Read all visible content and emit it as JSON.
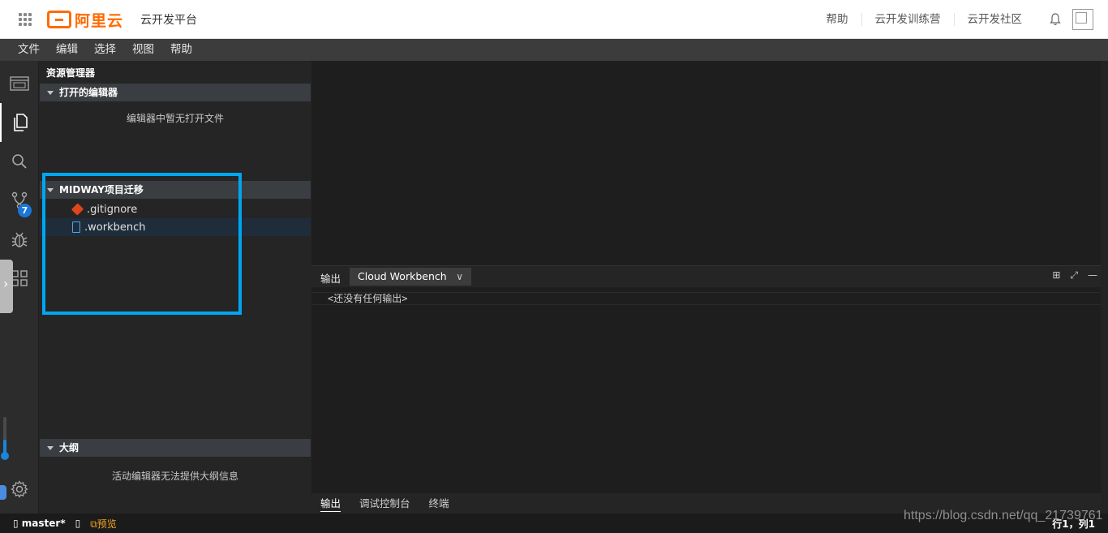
{
  "header": {
    "brand": "阿里云",
    "platform": "云开发平台",
    "links": [
      "帮助",
      "云开发训练营",
      "云开发社区"
    ]
  },
  "menubar": {
    "items": [
      "文件",
      "编辑",
      "选择",
      "视图",
      "帮助"
    ]
  },
  "activitybar": {
    "scm_badge": "7"
  },
  "sidebar": {
    "title": "资源管理器",
    "open_editors": {
      "label": "打开的编辑器",
      "empty_text": "编辑器中暂无打开文件"
    },
    "project": {
      "label": "MIDWAY项目迁移",
      "files": [
        {
          "name": ".gitignore",
          "icon": "git-file-icon"
        },
        {
          "name": ".workbench",
          "icon": "file-icon"
        }
      ]
    },
    "outline": {
      "label": "大纲",
      "empty_text": "活动编辑器无法提供大纲信息"
    }
  },
  "panel": {
    "tab_label": "输出",
    "channel": "Cloud Workbench",
    "output_text": "<还没有任何输出>"
  },
  "bottom_tabs": [
    "输出",
    "调试控制台",
    "终端"
  ],
  "statusbar": {
    "branch": "master*",
    "sync": "▯",
    "preview": "预览",
    "cursor": "行1，列1"
  },
  "watermark": "https://blog.csdn.net/qq_21739761",
  "colors": {
    "accent": "#ff6a00",
    "highlight": "#00a6ef",
    "badge": "#1877d8"
  }
}
